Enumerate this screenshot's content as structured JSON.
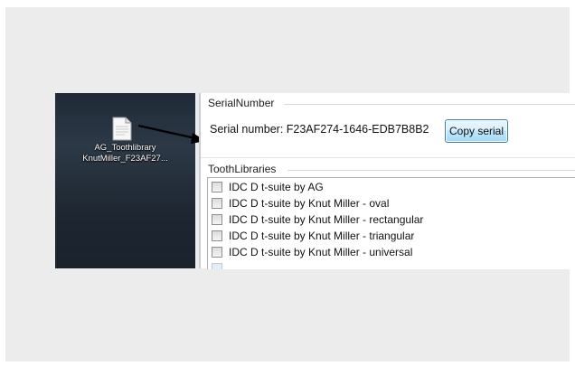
{
  "desktop": {
    "file_icon": "document-icon",
    "file_label_line1": "AG_Toothlibrary",
    "file_label_line2": "KnutMiller_F23AF27..."
  },
  "app": {
    "serial_group_title": "SerialNumber",
    "serial_label": "Serial number: F23AF274-1646-EDB7B8B2",
    "copy_button_label": "Copy serial",
    "libraries_group_title": "ToothLibraries",
    "libraries": [
      "IDC D t-suite by AG",
      "IDC D t-suite by Knut Miller - oval",
      "IDC D t-suite by Knut Miller - rectangular",
      "IDC D t-suite by Knut Miller - triangular",
      "IDC D t-suite by Knut Miller - universal"
    ]
  },
  "colors": {
    "button_border": "#3c7fb1",
    "desktop_bg": "#1f2a36",
    "arrow": "#000000"
  }
}
